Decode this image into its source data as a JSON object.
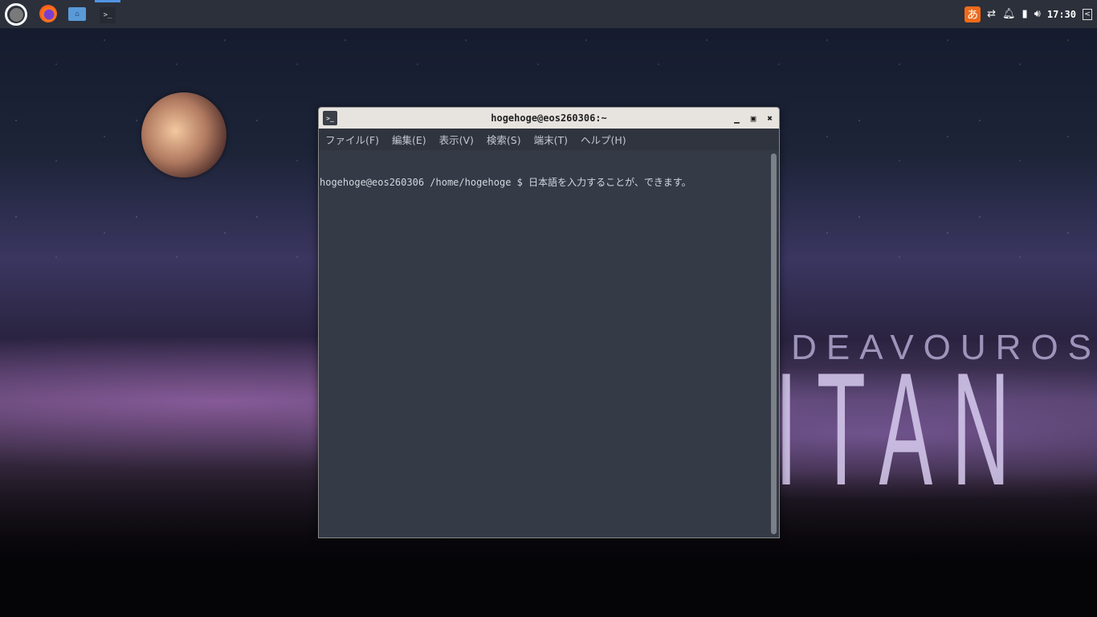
{
  "wallpaper": {
    "logo_top": "ENDEAVOUROS",
    "logo_bottom": "TITAN"
  },
  "panel": {
    "launchers": [
      {
        "icon": "app-menu-icon"
      },
      {
        "icon": "firefox-icon"
      },
      {
        "icon": "file-manager-icon"
      },
      {
        "icon": "terminal-icon",
        "active": true
      }
    ],
    "tray": {
      "ime": "あ",
      "clock": "17:30"
    }
  },
  "terminal": {
    "title": "hogehoge@eos260306:~",
    "icon_glyph": ">_",
    "menu": [
      "ファイル(F)",
      "編集(E)",
      "表示(V)",
      "検索(S)",
      "端末(T)",
      "ヘルプ(H)"
    ],
    "line": "hogehoge@eos260306 /home/hogehoge $ 日本語を入力することが、できます。"
  },
  "colors": {
    "panel": "#2b303b",
    "accent": "#5294e2",
    "terminal_bg": "#343a46"
  }
}
